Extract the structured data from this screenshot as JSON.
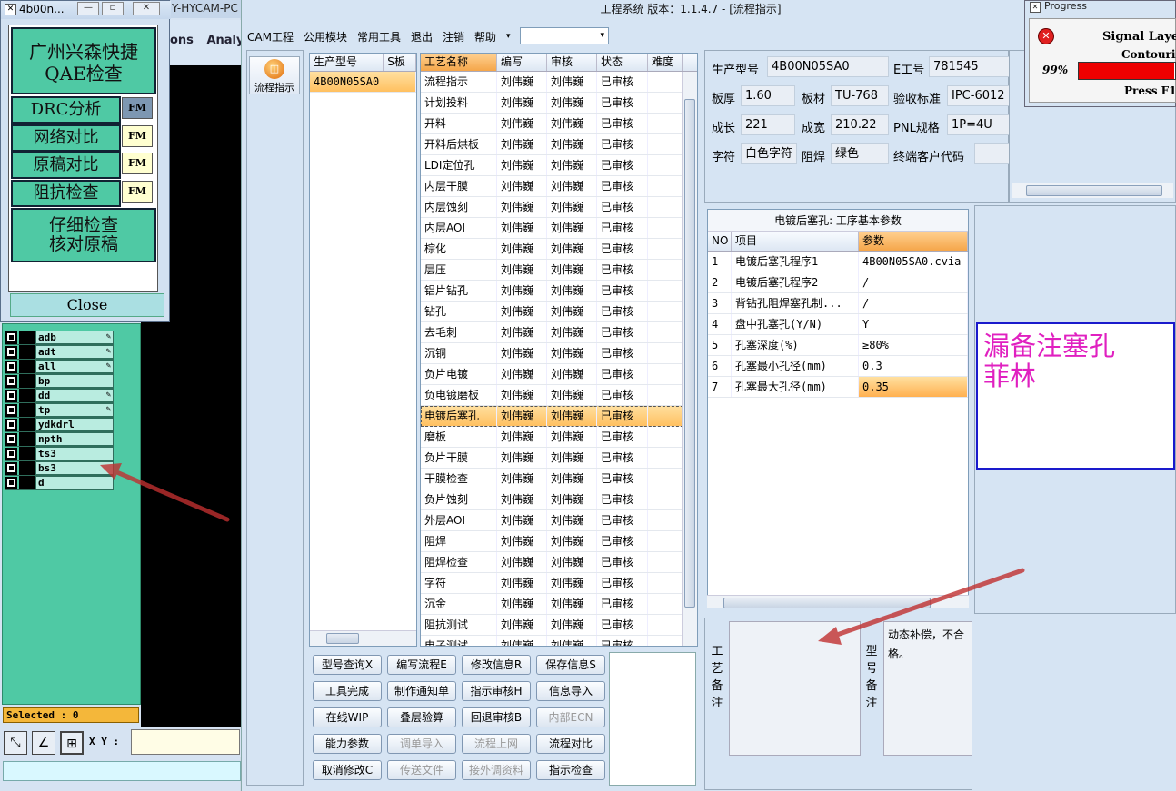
{
  "bg_app": {
    "title": "Y-HYCAM-PC",
    "menu": [
      "ons",
      "Analy"
    ]
  },
  "layers": [
    {
      "name": "adb",
      "flag": true
    },
    {
      "name": "adt",
      "flag": true
    },
    {
      "name": "all",
      "flag": true
    },
    {
      "name": "bp",
      "flag": false
    },
    {
      "name": "dd",
      "flag": true
    },
    {
      "name": "tp",
      "flag": true
    },
    {
      "name": "ydkdrl",
      "flag": false
    },
    {
      "name": "npth",
      "flag": false
    },
    {
      "name": "ts3",
      "flag": false
    },
    {
      "name": "bs3",
      "flag": false
    },
    {
      "name": "d",
      "flag": false
    }
  ],
  "selected_label": "Selected : 0",
  "xy_label": "X Y :",
  "popup": {
    "title": "4b00n...",
    "btn_qae_line1": "广州兴森快捷",
    "btn_qae_line2": "QAE检查",
    "btn_drc": "DRC分析",
    "btn_net": "网络对比",
    "btn_orig": "原稿对比",
    "btn_imp": "阻抗检查",
    "fm": "FM",
    "btn_detail_line1": "仔细检查",
    "btn_detail_line2": "核对原稿",
    "close": "Close"
  },
  "main": {
    "title": "工程系统   版本：1.1.4.7 - [流程指示]",
    "menu": [
      "CAM工程",
      "公用模块",
      "常用工具",
      "退出",
      "注销",
      "帮助"
    ],
    "nav_label": "流程指示"
  },
  "model_table": {
    "headers": [
      "生产型号",
      "S板"
    ],
    "rows": [
      "4B00N05SA0"
    ]
  },
  "process_table": {
    "headers": [
      "工艺名称",
      "编写",
      "审核",
      "状态",
      "难度"
    ],
    "author": "刘伟巍",
    "status": "已审核",
    "selected_index": 16,
    "rows": [
      "流程指示",
      "计划投料",
      "开料",
      "开料后烘板",
      "LDI定位孔",
      "内层干膜",
      "内层蚀刻",
      "内层AOI",
      "棕化",
      "层压",
      "铝片钻孔",
      "钻孔",
      "去毛刺",
      "沉铜",
      "负片电镀",
      "负电镀磨板",
      "电镀后塞孔",
      "磨板",
      "负片干膜",
      "干膜检查",
      "负片蚀刻",
      "外层AOI",
      "阻焊",
      "阻焊检查",
      "字符",
      "沉金",
      "阻抗测试",
      "电子测试"
    ]
  },
  "buttons": [
    [
      {
        "label": "型号查询X",
        "enabled": true
      },
      {
        "label": "编写流程E",
        "enabled": true
      },
      {
        "label": "修改信息R",
        "enabled": true
      },
      {
        "label": "保存信息S",
        "enabled": true
      }
    ],
    [
      {
        "label": "工具完成",
        "enabled": true
      },
      {
        "label": "制作通知单",
        "enabled": true
      },
      {
        "label": "指示审核H",
        "enabled": true
      },
      {
        "label": "信息导入",
        "enabled": true
      }
    ],
    [
      {
        "label": "在线WIP",
        "enabled": true
      },
      {
        "label": "叠层验算",
        "enabled": true
      },
      {
        "label": "回退审核B",
        "enabled": true
      },
      {
        "label": "内部ECN",
        "enabled": false
      }
    ],
    [
      {
        "label": "能力参数",
        "enabled": true
      },
      {
        "label": "调单导入",
        "enabled": false
      },
      {
        "label": "流程上网",
        "enabled": false
      },
      {
        "label": "流程对比",
        "enabled": true
      }
    ],
    [
      {
        "label": "取消修改C",
        "enabled": true
      },
      {
        "label": "传送文件",
        "enabled": false
      },
      {
        "label": "接外调资料",
        "enabled": false
      },
      {
        "label": "指示检查",
        "enabled": true
      }
    ]
  ],
  "info": {
    "model_label": "生产型号",
    "model": "4B00N05SA0",
    "eno_label": "E工号",
    "eno": "781545",
    "thick_label": "板厚",
    "thick": "1.60",
    "material_label": "板材",
    "material": "TU-768",
    "std_label": "验收标准",
    "std": "IPC-6012",
    "len_label": "成长",
    "len": "221",
    "width_label": "成宽",
    "width": "210.22",
    "pnl_label": "PNL规格",
    "pnl": "1P=4U",
    "char_label": "字符",
    "char": "白色字符",
    "mask_label": "阻焊",
    "mask": "绿色",
    "cust_label": "终端客户代码",
    "cust": ""
  },
  "param_table": {
    "title": "电镀后塞孔: 工序基本参数",
    "headers": [
      "NO",
      "项目",
      "参数"
    ],
    "selected_index": 6,
    "rows": [
      {
        "no": "1",
        "item": "电镀后塞孔程序1",
        "value": "4B00N05SA0.cvia"
      },
      {
        "no": "2",
        "item": "电镀后塞孔程序2",
        "value": "/"
      },
      {
        "no": "3",
        "item": "背钻孔阻焊塞孔制...",
        "value": "/"
      },
      {
        "no": "4",
        "item": "盘中孔塞孔(Y/N)",
        "value": "Y"
      },
      {
        "no": "5",
        "item": "孔塞深度(%)",
        "value": "≥80%"
      },
      {
        "no": "6",
        "item": "孔塞最小孔径(mm)",
        "value": "0.3"
      },
      {
        "no": "7",
        "item": "孔塞最大孔径(mm)",
        "value": "0.35"
      }
    ]
  },
  "note_text_line1": "漏备注塞孔",
  "note_text_line2": "菲林",
  "remarks": {
    "process_label": [
      "工",
      "艺",
      "备",
      "注"
    ],
    "model_label": [
      "型",
      "号",
      "备",
      "注"
    ],
    "model_text": "动态补偿，不合格。"
  },
  "progress": {
    "title": "Progress",
    "layer": "Signal Layer",
    "op": "Contouriz",
    "percent": "99%",
    "percent_value": 0.99,
    "hint": "Press F1"
  },
  "colors": {
    "accent_green": "#4fc9a4",
    "note_text": "#e020c0",
    "note_border": "#1a1acc",
    "selected_row": "#ffc060"
  }
}
